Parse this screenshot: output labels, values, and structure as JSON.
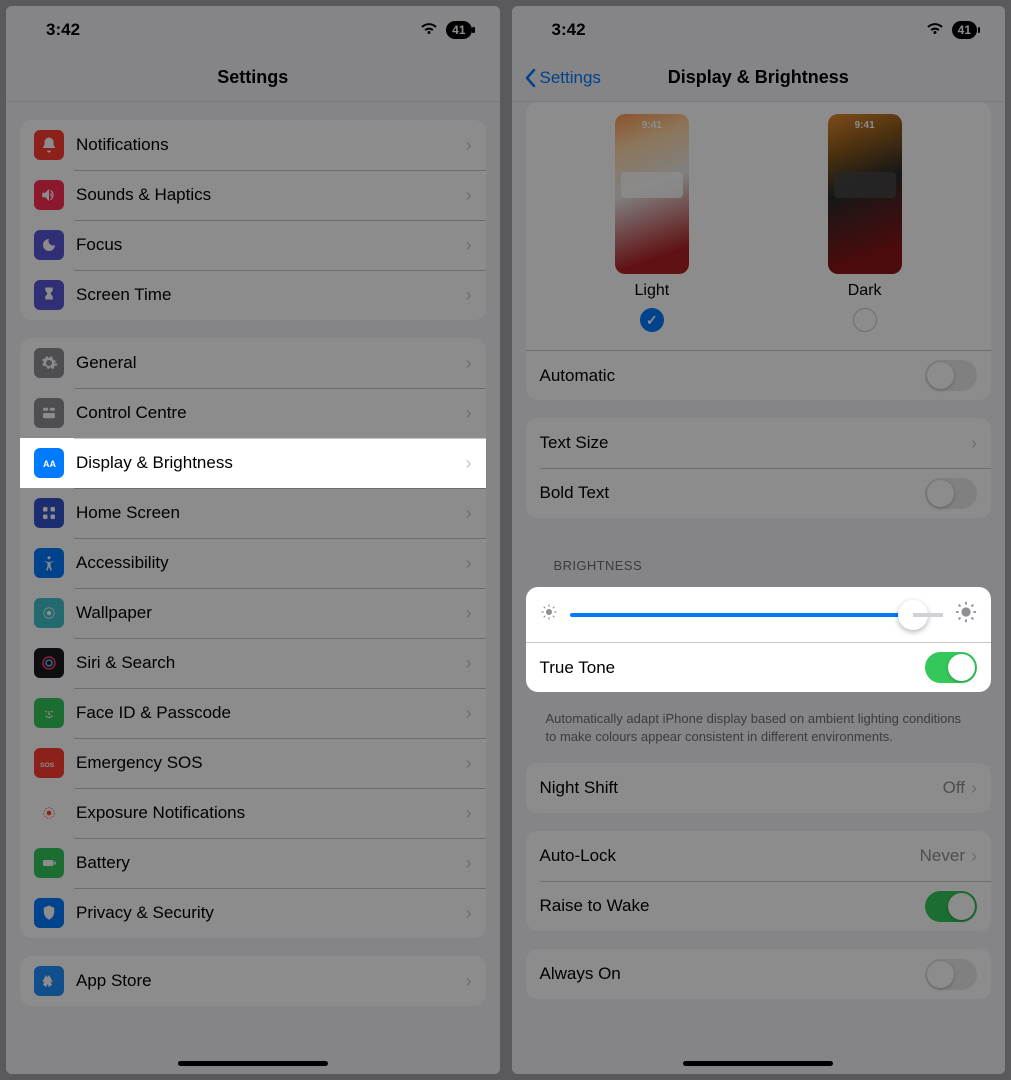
{
  "status": {
    "time": "3:42",
    "battery": "41"
  },
  "left": {
    "title": "Settings",
    "group1": [
      {
        "name": "notifications",
        "label": "Notifications",
        "icon_bg": "#ff3b30"
      },
      {
        "name": "sounds-haptics",
        "label": "Sounds & Haptics",
        "icon_bg": "#ff2d55"
      },
      {
        "name": "focus",
        "label": "Focus",
        "icon_bg": "#5856d6"
      },
      {
        "name": "screen-time",
        "label": "Screen Time",
        "icon_bg": "#5856d6"
      }
    ],
    "group2": [
      {
        "name": "general",
        "label": "General",
        "icon_bg": "#8e8e93"
      },
      {
        "name": "control-centre",
        "label": "Control Centre",
        "icon_bg": "#8e8e93"
      },
      {
        "name": "display-brightness",
        "label": "Display & Brightness",
        "icon_bg": "#007aff",
        "highlight": true
      },
      {
        "name": "home-screen",
        "label": "Home Screen",
        "icon_bg": "#3355cc"
      },
      {
        "name": "accessibility",
        "label": "Accessibility",
        "icon_bg": "#007aff"
      },
      {
        "name": "wallpaper",
        "label": "Wallpaper",
        "icon_bg": "#3ec1c9"
      },
      {
        "name": "siri-search",
        "label": "Siri & Search",
        "icon_bg": "#1b1b1e"
      },
      {
        "name": "face-id-passcode",
        "label": "Face ID & Passcode",
        "icon_bg": "#34c759"
      },
      {
        "name": "emergency-sos",
        "label": "Emergency SOS",
        "icon_bg": "#ff3b30"
      },
      {
        "name": "exposure-notifications",
        "label": "Exposure Notifications",
        "icon_bg": "#ffffff"
      },
      {
        "name": "battery",
        "label": "Battery",
        "icon_bg": "#34c759"
      },
      {
        "name": "privacy-security",
        "label": "Privacy & Security",
        "icon_bg": "#007aff"
      }
    ],
    "group3": [
      {
        "name": "app-store",
        "label": "App Store",
        "icon_bg": "#1e90ff"
      }
    ]
  },
  "right": {
    "back_label": "Settings",
    "title": "Display & Brightness",
    "thumb_time": "9:41",
    "light_label": "Light",
    "dark_label": "Dark",
    "automatic_label": "Automatic",
    "automatic_on": false,
    "text_size_label": "Text Size",
    "bold_text_label": "Bold Text",
    "bold_text_on": false,
    "brightness_header": "BRIGHTNESS",
    "brightness_percent": 92,
    "true_tone_label": "True Tone",
    "true_tone_on": true,
    "true_tone_desc": "Automatically adapt iPhone display based on ambient lighting conditions to make colours appear consistent in different environments.",
    "night_shift_label": "Night Shift",
    "night_shift_value": "Off",
    "auto_lock_label": "Auto-Lock",
    "auto_lock_value": "Never",
    "raise_to_wake_label": "Raise to Wake",
    "raise_to_wake_on": true,
    "always_on_label": "Always On"
  }
}
